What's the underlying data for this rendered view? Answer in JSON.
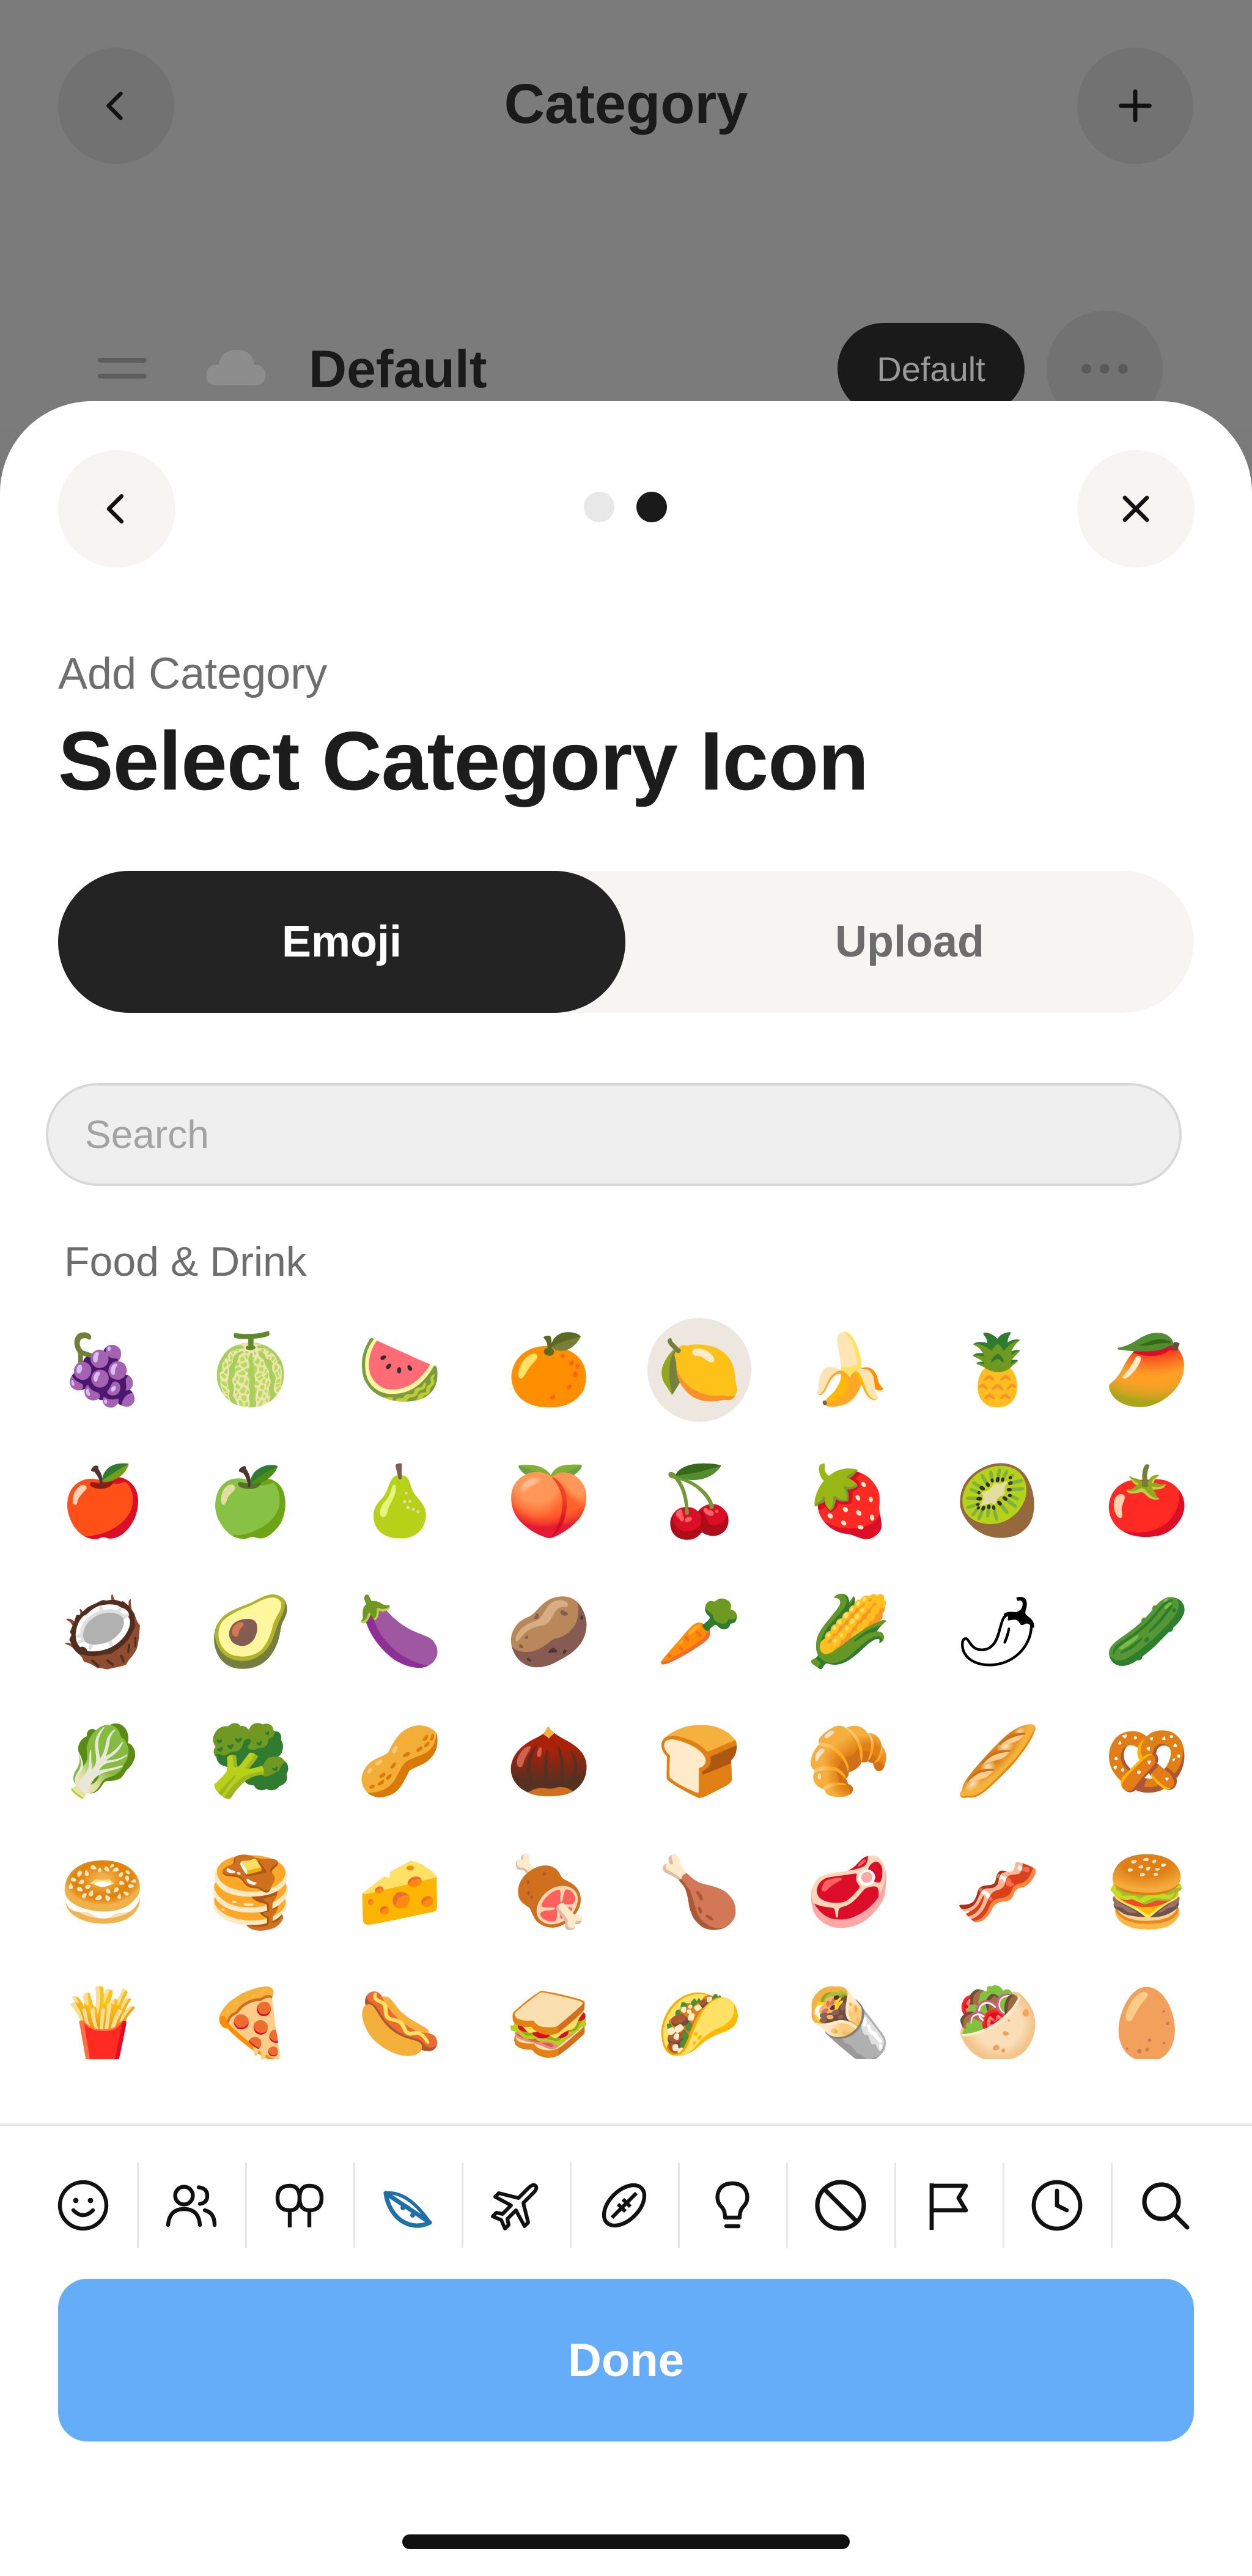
{
  "background": {
    "title": "Category",
    "row_label": "Default",
    "row_badge": "Default"
  },
  "sheet": {
    "pages_total": 2,
    "page_current": 2,
    "subtitle": "Add Category",
    "title": "Select Category Icon",
    "tabs": [
      {
        "label": "Emoji",
        "active": true
      },
      {
        "label": "Upload",
        "active": false
      }
    ],
    "search": {
      "placeholder": "Search",
      "value": ""
    },
    "section_label": "Food & Drink",
    "emojis": [
      "🍇",
      "🍈",
      "🍉",
      "🍊",
      "🍋",
      "🍌",
      "🍍",
      "🥭",
      "🍎",
      "🍏",
      "🍐",
      "🍑",
      "🍒",
      "🍓",
      "🥝",
      "🍅",
      "🥥",
      "🥑",
      "🍆",
      "🥔",
      "🥕",
      "🌽",
      "🌶",
      "🥒",
      "🥬",
      "🥦",
      "🥜",
      "🌰",
      "🍞",
      "🥐",
      "🥖",
      "🥨",
      "🥯",
      "🥞",
      "🧀",
      "🍖",
      "🍗",
      "🥩",
      "🥓",
      "🍔",
      "🍟",
      "🍕",
      "🌭",
      "🥪",
      "🌮",
      "🌯",
      "🥙",
      "🥚"
    ],
    "selected_emoji": "🍋",
    "category_tabs": [
      {
        "icon": "smiley-icon",
        "active": false
      },
      {
        "icon": "people-icon",
        "active": false
      },
      {
        "icon": "nature-icon",
        "active": false
      },
      {
        "icon": "food-icon",
        "active": true
      },
      {
        "icon": "travel-icon",
        "active": false
      },
      {
        "icon": "activity-icon",
        "active": false
      },
      {
        "icon": "objects-icon",
        "active": false
      },
      {
        "icon": "symbols-icon",
        "active": false
      },
      {
        "icon": "flags-icon",
        "active": false
      },
      {
        "icon": "recent-icon",
        "active": false
      },
      {
        "icon": "search-icon",
        "active": false
      }
    ],
    "done_label": "Done"
  },
  "colors": {
    "accent": "#66adf9",
    "active_category": "#1f6fa8",
    "dark_pill": "#232323",
    "selected_emoji_bg": "#ede7df"
  }
}
